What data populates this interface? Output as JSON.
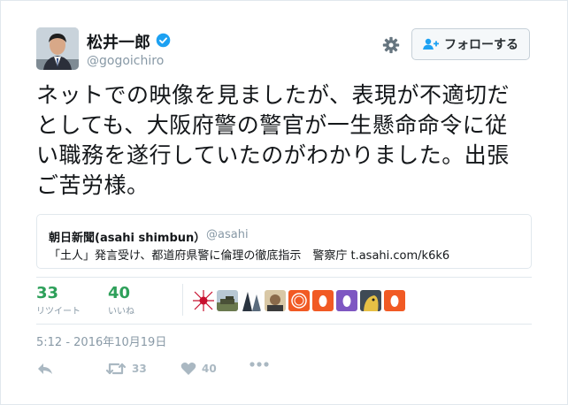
{
  "user": {
    "name": "松井一郎",
    "handle": "@gogoichiro"
  },
  "follow_label": "フォローする",
  "tweet": {
    "lines": [
      "ネットでの映像を見ましたが、表現が不適切だ",
      "としても、大阪府警の警官が一生懸命命令に従",
      "い職務を遂行していたのがわかりました。出張",
      "ご苦労様。"
    ]
  },
  "quote": {
    "name": "朝日新聞(asahi shimbun）",
    "handle": "@asahi",
    "text": "「土人」発言受け、都道府県警に倫理の徹底指示　警察庁 t.asahi.com/k6k6"
  },
  "stats": {
    "retweets": {
      "count": "33",
      "label": "リツイート"
    },
    "likes": {
      "count": "40",
      "label": "いいね"
    }
  },
  "timestamp": "5:12 - 2016年10月19日",
  "actions": {
    "retweet_count": "33",
    "like_count": "40"
  },
  "colors": {
    "stat_green": "#2ea05a",
    "orange": "#f15a24",
    "purple": "#7e57c2",
    "verified_blue": "#1da1f2"
  },
  "icons": [
    "verified-icon",
    "gear-icon",
    "follow-person-icon",
    "reply-icon",
    "retweet-icon",
    "heart-icon",
    "more-icon"
  ]
}
